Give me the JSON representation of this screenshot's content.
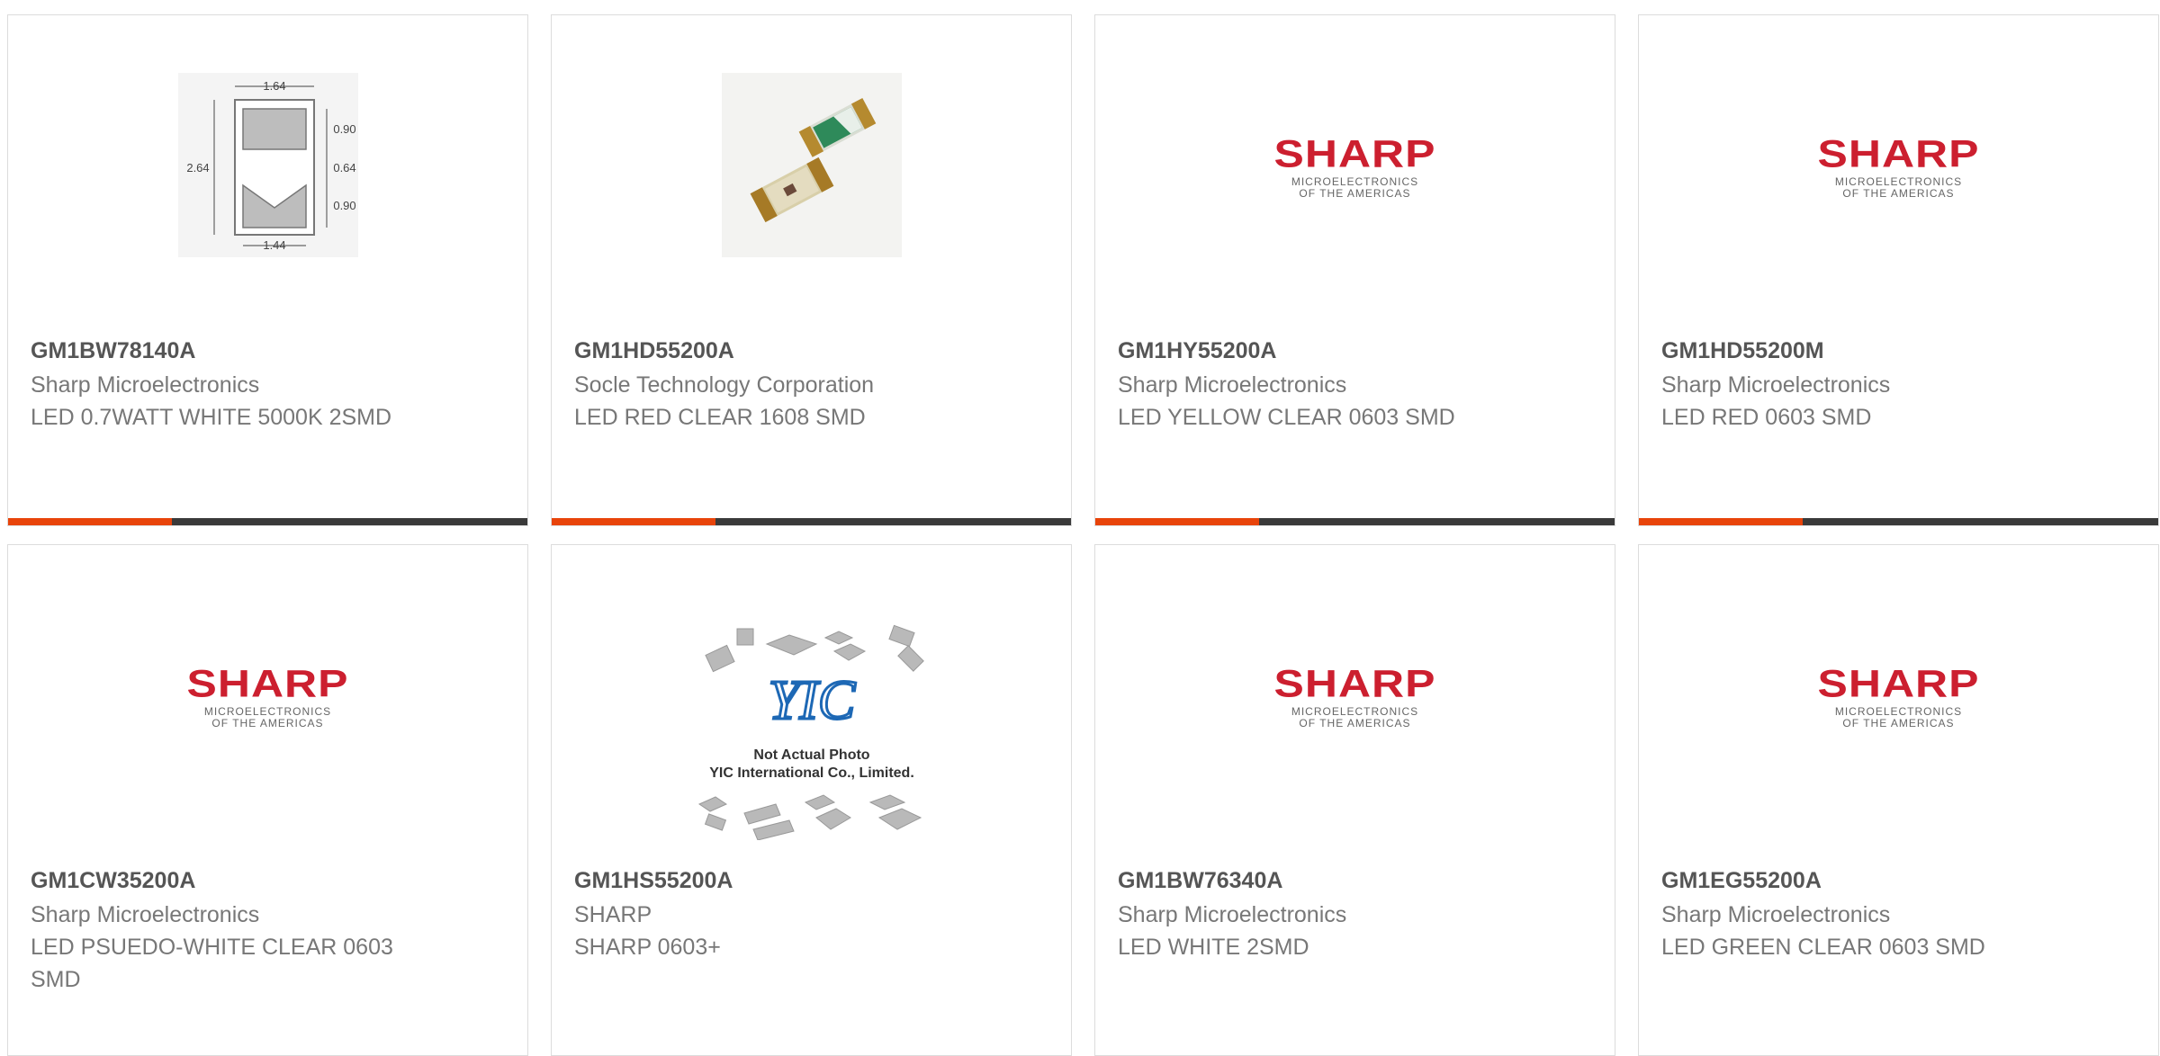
{
  "colors": {
    "accent": "#e8440a",
    "bar": "#3a3a3a",
    "sharp_red": "#cc1f2f"
  },
  "products": [
    {
      "part_number": "GM1BW78140A",
      "manufacturer": "Sharp Microelectronics",
      "description": "LED 0.7WATT WHITE 5000K 2SMD",
      "image": "dimension-drawing",
      "image_labels": [
        "1.64",
        "2.64",
        "0.90",
        "0.64",
        "0.90",
        "1.44"
      ]
    },
    {
      "part_number": "GM1HD55200A",
      "manufacturer": "Socle Technology Corporation",
      "description": "LED RED CLEAR 1608 SMD",
      "image": "smd-led-photo"
    },
    {
      "part_number": "GM1HY55200A",
      "manufacturer": "Sharp Microelectronics",
      "description": "LED YELLOW CLEAR 0603 SMD",
      "image": "sharp-logo"
    },
    {
      "part_number": "GM1HD55200M",
      "manufacturer": "Sharp Microelectronics",
      "description": "LED RED 0603 SMD",
      "image": "sharp-logo"
    },
    {
      "part_number": "GM1CW35200A",
      "manufacturer": "Sharp Microelectronics",
      "description": "LED PSUEDO-WHITE CLEAR 0603 SMD",
      "image": "sharp-logo"
    },
    {
      "part_number": "GM1HS55200A",
      "manufacturer": "SHARP",
      "description": "SHARP 0603+",
      "image": "yic-placeholder",
      "image_labels": [
        "YIC",
        "Not Actual Photo",
        "YIC International Co., Limited."
      ]
    },
    {
      "part_number": "GM1BW76340A",
      "manufacturer": "Sharp Microelectronics",
      "description": "LED WHITE 2SMD",
      "image": "sharp-logo"
    },
    {
      "part_number": "GM1EG55200A",
      "manufacturer": "Sharp Microelectronics",
      "description": "LED GREEN CLEAR 0603 SMD",
      "image": "sharp-logo"
    }
  ],
  "sharp_logo": {
    "wordmark": "SHARP",
    "line1": "MICROELECTRONICS",
    "line2": "OF THE AMERICAS"
  }
}
